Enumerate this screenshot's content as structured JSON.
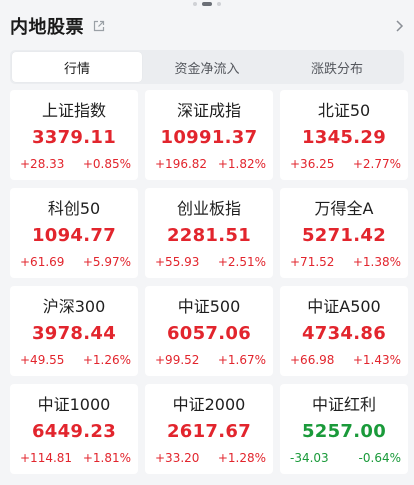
{
  "header": {
    "title": "内地股票"
  },
  "tabs": [
    {
      "label": "行情",
      "active": true
    },
    {
      "label": "资金净流入",
      "active": false
    },
    {
      "label": "涨跌分布",
      "active": false
    }
  ],
  "colors": {
    "up": "#e2252d",
    "down": "#1a9a3a"
  },
  "cards": [
    {
      "name": "上证指数",
      "value": "3379.11",
      "change": "+28.33",
      "pct": "+0.85%",
      "trend": "up"
    },
    {
      "name": "深证成指",
      "value": "10991.37",
      "change": "+196.82",
      "pct": "+1.82%",
      "trend": "up"
    },
    {
      "name": "北证50",
      "value": "1345.29",
      "change": "+36.25",
      "pct": "+2.77%",
      "trend": "up"
    },
    {
      "name": "科创50",
      "value": "1094.77",
      "change": "+61.69",
      "pct": "+5.97%",
      "trend": "up"
    },
    {
      "name": "创业板指",
      "value": "2281.51",
      "change": "+55.93",
      "pct": "+2.51%",
      "trend": "up"
    },
    {
      "name": "万得全A",
      "value": "5271.42",
      "change": "+71.52",
      "pct": "+1.38%",
      "trend": "up"
    },
    {
      "name": "沪深300",
      "value": "3978.44",
      "change": "+49.55",
      "pct": "+1.26%",
      "trend": "up"
    },
    {
      "name": "中证500",
      "value": "6057.06",
      "change": "+99.52",
      "pct": "+1.67%",
      "trend": "up"
    },
    {
      "name": "中证A500",
      "value": "4734.86",
      "change": "+66.98",
      "pct": "+1.43%",
      "trend": "up"
    },
    {
      "name": "中证1000",
      "value": "6449.23",
      "change": "+114.81",
      "pct": "+1.81%",
      "trend": "up"
    },
    {
      "name": "中证2000",
      "value": "2617.67",
      "change": "+33.20",
      "pct": "+1.28%",
      "trend": "up"
    },
    {
      "name": "中证红利",
      "value": "5257.00",
      "change": "-34.03",
      "pct": "-0.64%",
      "trend": "down"
    }
  ]
}
